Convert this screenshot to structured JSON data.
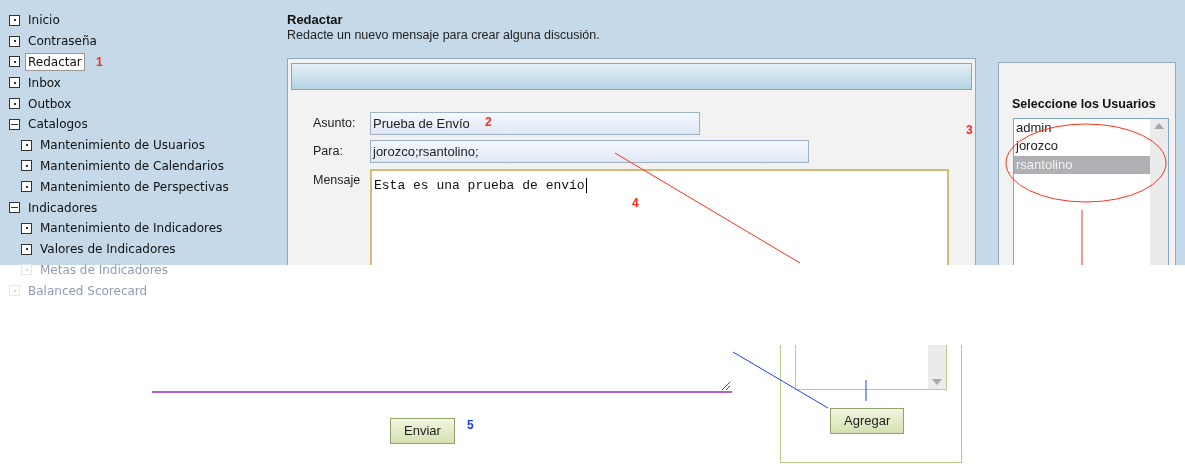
{
  "sidebar": {
    "items": [
      {
        "label": "Inicio",
        "kind": "leaf",
        "selected": false,
        "faded": false
      },
      {
        "label": "Contraseña",
        "kind": "leaf",
        "selected": false,
        "faded": false
      },
      {
        "label": "Redactar",
        "kind": "leaf",
        "selected": true,
        "faded": false
      },
      {
        "label": "Inbox",
        "kind": "leaf",
        "selected": false,
        "faded": false
      },
      {
        "label": "Outbox",
        "kind": "leaf",
        "selected": false,
        "faded": false
      },
      {
        "label": "Catalogos",
        "kind": "folder",
        "expanded": true,
        "selected": false,
        "faded": false,
        "children": [
          {
            "label": "Mantenimiento de Usuarios",
            "kind": "leaf",
            "selected": false,
            "faded": false
          },
          {
            "label": "Mantenimiento de Calendarios",
            "kind": "leaf",
            "selected": false,
            "faded": false
          },
          {
            "label": "Mantenimiento de Perspectivas",
            "kind": "leaf",
            "selected": false,
            "faded": false
          }
        ]
      },
      {
        "label": "Indicadores",
        "kind": "folder",
        "expanded": true,
        "selected": false,
        "faded": false,
        "children": [
          {
            "label": "Mantenimiento de Indicadores",
            "kind": "leaf",
            "selected": false,
            "faded": false
          },
          {
            "label": "Valores de Indicadores",
            "kind": "leaf",
            "selected": false,
            "faded": false
          },
          {
            "label": "Metas de Indicadores",
            "kind": "leaf",
            "selected": false,
            "faded": true
          }
        ]
      },
      {
        "label": "Balanced Scorecard",
        "kind": "leaf",
        "selected": false,
        "faded": true
      }
    ]
  },
  "page": {
    "title": "Redactar",
    "subtitle": "Redacte un nuevo mensaje para crear alguna discusión."
  },
  "form": {
    "subject": {
      "label": "Asunto:",
      "value": "Prueba de Envío"
    },
    "to": {
      "label": "Para:",
      "value": "jorozco;rsantolino;"
    },
    "message": {
      "label": "Mensaje",
      "value": "Esta es una prueba de envío"
    },
    "send_button": "Enviar"
  },
  "users": {
    "title": "Seleccione los Usuarios",
    "options": [
      {
        "label": "admin",
        "selected": false
      },
      {
        "label": "jorozco",
        "selected": false
      },
      {
        "label": "rsantolino",
        "selected": true
      }
    ],
    "add_button": "Agregar"
  },
  "annotations": [
    {
      "text": "1",
      "color": "#ff2a1a"
    },
    {
      "text": "2",
      "color": "#ff2a1a"
    },
    {
      "text": "3",
      "color": "#ff2a1a"
    },
    {
      "text": "4",
      "color": "#ff2a1a"
    },
    {
      "text": "5",
      "color": "#1a3cff"
    }
  ]
}
